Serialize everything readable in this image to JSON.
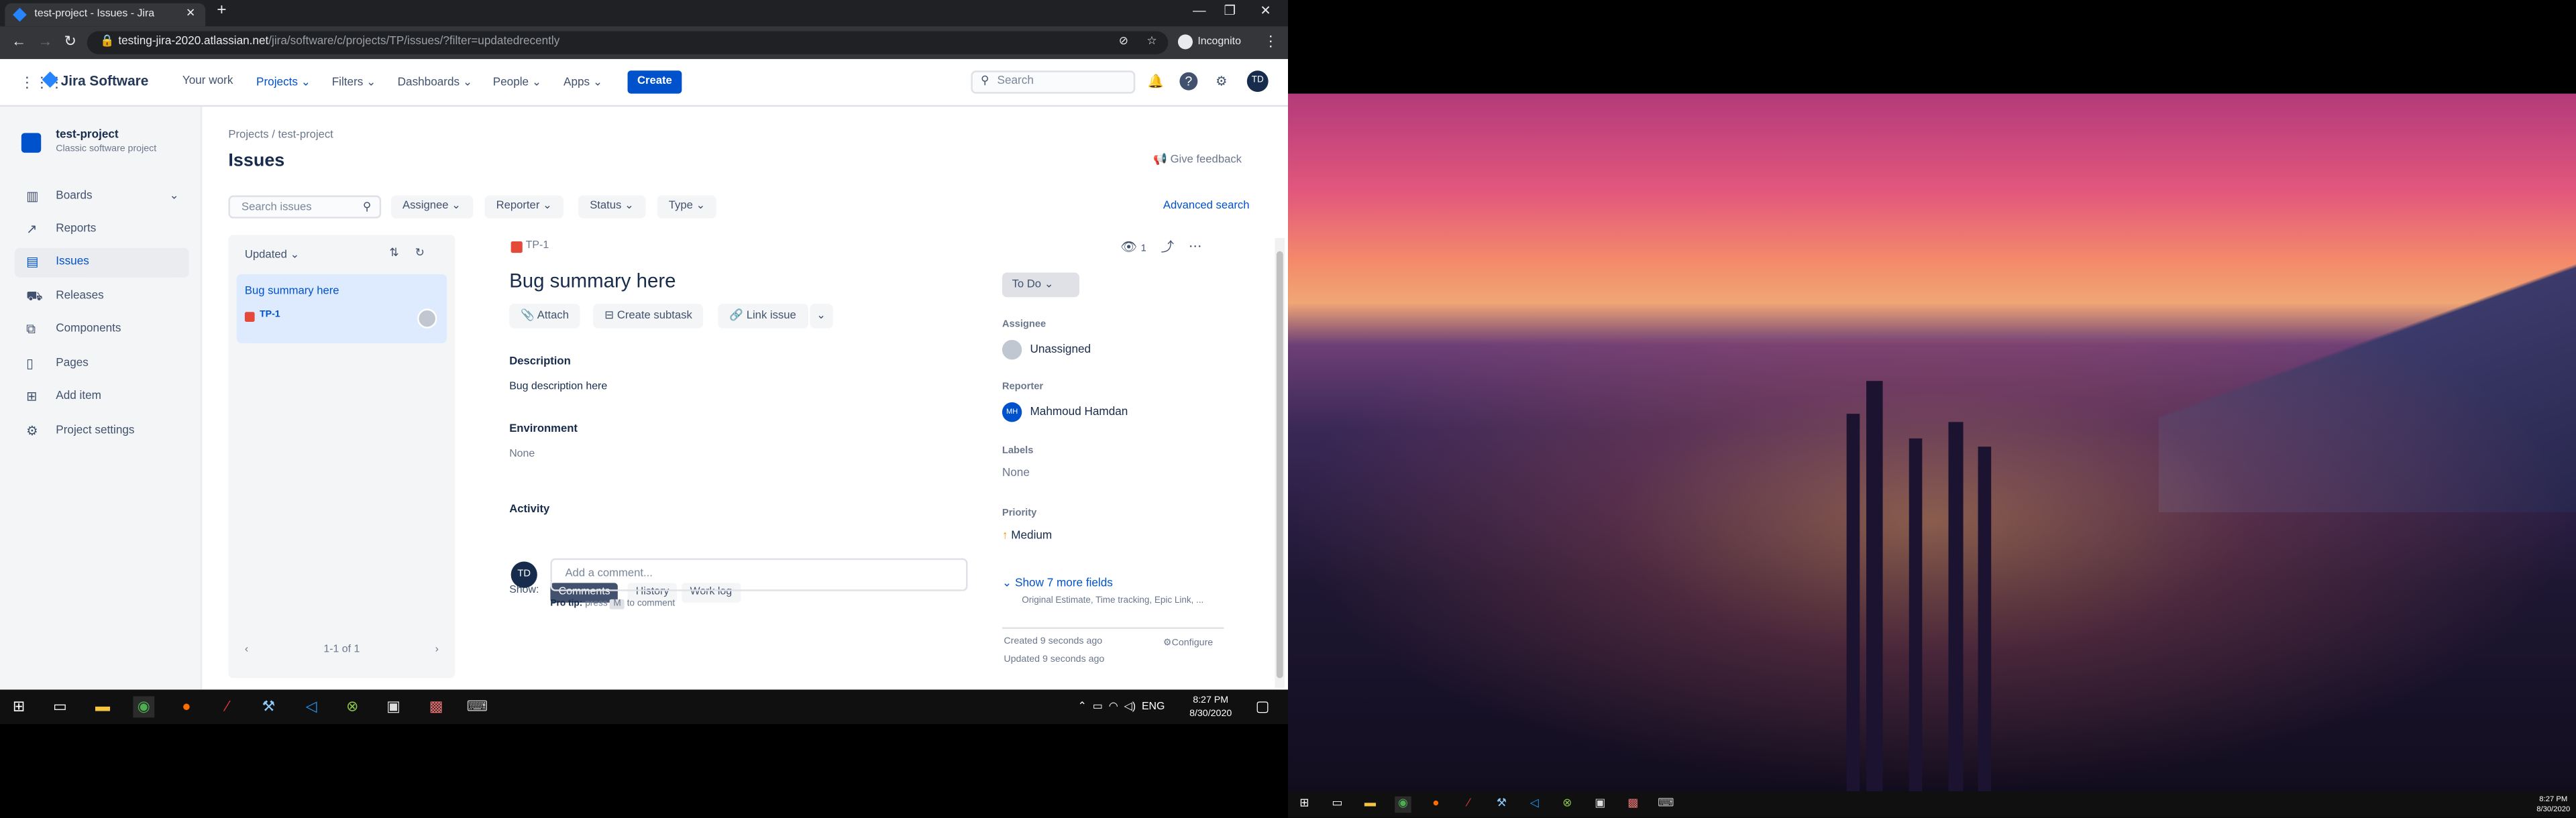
{
  "browser": {
    "tab_title": "test-project - Issues - Jira",
    "url_host": "testing-jira-2020.atlassian.net",
    "url_path": "/jira/software/c/projects/TP/issues/?filter=updatedrecently",
    "incognito_label": "Incognito"
  },
  "topnav": {
    "product": "Jira Software",
    "items": [
      "Your work",
      "Projects",
      "Filters",
      "Dashboards",
      "People",
      "Apps"
    ],
    "create_label": "Create",
    "search_placeholder": "Search",
    "avatar_initials": "TD"
  },
  "sidebar": {
    "project_name": "test-project",
    "project_type": "Classic software project",
    "items": [
      "Boards",
      "Reports",
      "Issues",
      "Releases",
      "Components",
      "Pages",
      "Add item",
      "Project settings"
    ]
  },
  "main": {
    "breadcrumb_root": "Projects",
    "breadcrumb_sep": "/",
    "breadcrumb_current": "test-project",
    "title": "Issues",
    "feedback": "Give feedback",
    "filters": {
      "search_placeholder": "Search issues",
      "assignee": "Assignee",
      "reporter": "Reporter",
      "status": "Status",
      "type": "Type",
      "advanced": "Advanced search"
    },
    "list": {
      "sort_label": "Updated",
      "card_summary": "Bug summary here",
      "card_key": "TP-1",
      "pagination": "1-1 of 1"
    },
    "detail": {
      "key": "TP-1",
      "watch_count": "1",
      "title": "Bug summary here",
      "buttons": [
        "Attach",
        "Create subtask",
        "Link issue"
      ],
      "description_label": "Description",
      "description": "Bug description here",
      "environment_label": "Environment",
      "environment": "None",
      "activity_label": "Activity",
      "show_label": "Show:",
      "activity_tabs": [
        "Comments",
        "History",
        "Work log"
      ],
      "comment_avatar": "TD",
      "comment_placeholder": "Add a comment...",
      "protip_bold": "Pro tip:",
      "protip_press": "press",
      "protip_key": "M",
      "protip_end": "to comment",
      "status": "To Do",
      "assignee_label": "Assignee",
      "assignee": "Unassigned",
      "reporter_label": "Reporter",
      "reporter_initials": "MH",
      "reporter": "Mahmoud Hamdan",
      "labels_label": "Labels",
      "labels": "None",
      "priority_label": "Priority",
      "priority": "Medium",
      "more_fields": "Show 7 more fields",
      "more_fields_sub": "Original Estimate, Time tracking, Epic Link, ...",
      "created": "Created 9 seconds ago",
      "updated": "Updated 9 seconds ago",
      "configure": "Configure"
    }
  },
  "taskbar": {
    "lang": "ENG",
    "time": "8:27 PM",
    "date": "8/30/2020"
  },
  "colors": {
    "primary": "#0052cc",
    "text": "#172b4d",
    "bug": "#e5493a",
    "priority_medium": "#ff8b00"
  }
}
